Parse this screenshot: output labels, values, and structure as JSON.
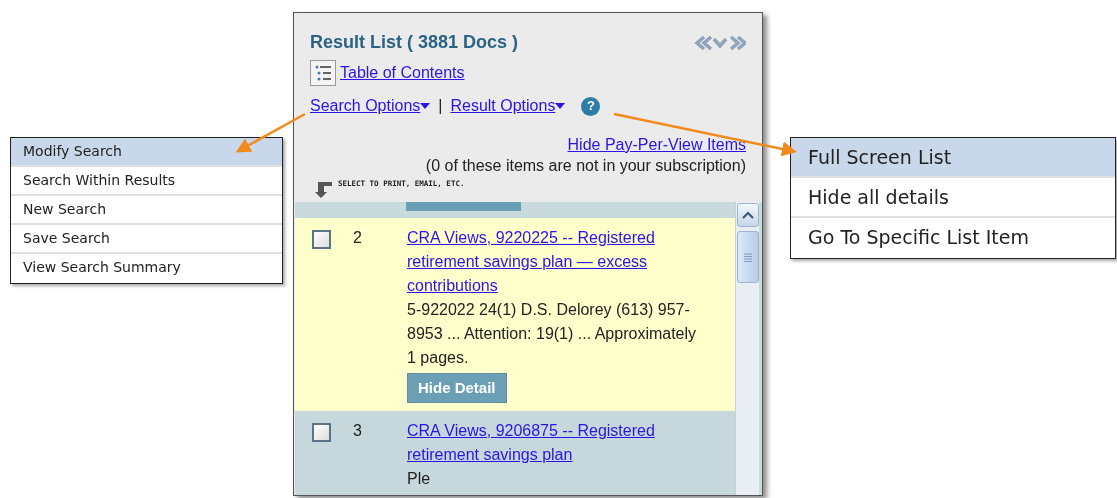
{
  "result_panel": {
    "title": "Result List ( 3881 Docs )",
    "toc_link": "Table of Contents",
    "search_options": "Search Options",
    "separator": "|",
    "result_options": "Result Options",
    "help_icon": "?",
    "hide_ppv_link": "Hide Pay-Per-View Items",
    "subscription_note": "(0 of these items are not in your subscription)",
    "select_hint": "SELECT TO PRINT, EMAIL, ETC.",
    "results": [
      {
        "number": "2",
        "checked": false,
        "highlighted": true,
        "title": "CRA Views, 9220225 -- Registered retirement savings plan — excess contributions",
        "snippet": "5-922022 24(1) D.S. Delorey (613) 957-8953 ... Attention: 19(1) ... Approximately 1 pages.",
        "detail_button": "Hide Detail"
      },
      {
        "number": "3",
        "checked": false,
        "highlighted": false,
        "title": "CRA Views, 9206875 -- Registered retirement savings plan",
        "snippet": "Ple"
      }
    ]
  },
  "search_options_menu": {
    "items": [
      {
        "label": "Modify Search",
        "selected": true
      },
      {
        "label": "Search Within Results",
        "selected": false
      },
      {
        "label": "New Search",
        "selected": false
      },
      {
        "label": "Save Search",
        "selected": false
      },
      {
        "label": "View Search Summary",
        "selected": false
      }
    ]
  },
  "result_options_menu": {
    "items": [
      {
        "label": "Full Screen List",
        "selected": true
      },
      {
        "label": "Hide all details",
        "selected": false
      },
      {
        "label": "Go To Specific List Item",
        "selected": false
      }
    ]
  }
}
